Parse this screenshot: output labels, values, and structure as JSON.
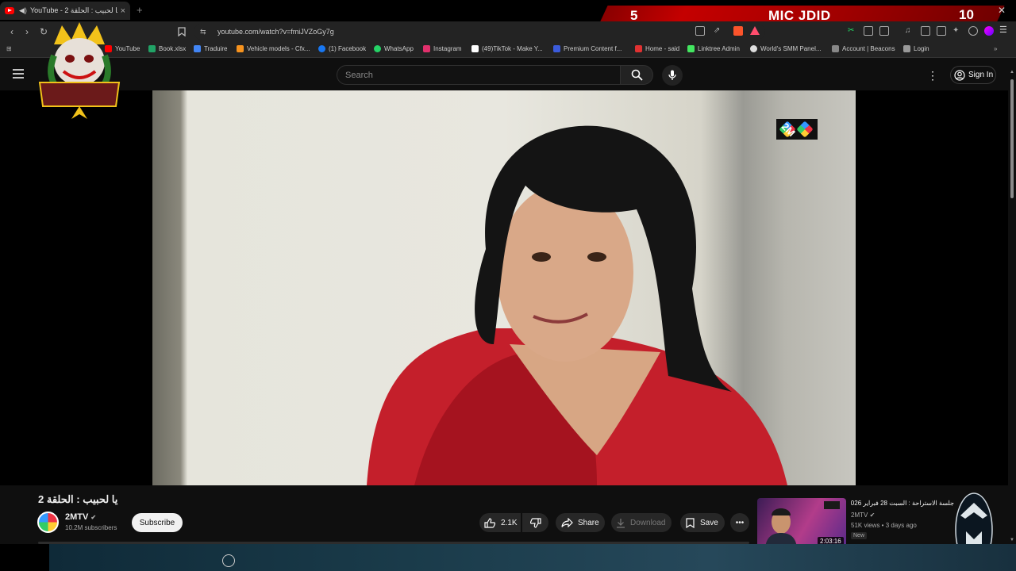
{
  "browser": {
    "tab_title": "YouTube - 2 يا لحبيب : الحلقة",
    "new_tab": "+",
    "url": "youtube.com/watch?v=fmiJVZoGy7g",
    "bookmarks": [
      {
        "label": "YouTube",
        "color": "#ff0000"
      },
      {
        "label": "Book.xlsx",
        "color": "#21a366"
      },
      {
        "label": "Traduire",
        "color": "#4285f4"
      },
      {
        "label": "Vehicle models - Cfx...",
        "color": "#f7931e"
      },
      {
        "label": "(1) Facebook",
        "color": "#1877f2"
      },
      {
        "label": "WhatsApp",
        "color": "#25d366"
      },
      {
        "label": "Instagram",
        "color": "#e1306c"
      },
      {
        "label": "(49)TikTok - Make Y...",
        "color": "#ffffff"
      },
      {
        "label": "Premium Content f...",
        "color": "#3b5bdb"
      },
      {
        "label": "Home - said",
        "color": "#e03131"
      },
      {
        "label": "Linktree Admin",
        "color": "#43e660"
      },
      {
        "label": "World's SMM Panel...",
        "color": "#dddddd"
      },
      {
        "label": "Account | Beacons",
        "color": "#888888"
      },
      {
        "label": "Login",
        "color": "#999999"
      }
    ]
  },
  "stream_overlay": {
    "left_number": "5",
    "title": "MIC JDID",
    "right_number": "10",
    "brand_text": "AIT BOUKHRIZ"
  },
  "youtube": {
    "search_placeholder": "Search",
    "sign_in": "Sign In",
    "watermark": "2M",
    "video_title": "يا لحبيب : الحلقة 2",
    "channel_name": "2MTV",
    "channel_subscribers": "10.2M subscribers",
    "subscribe": "Subscribe",
    "likes": "2.1K",
    "share": "Share",
    "download": "Download",
    "save": "Save",
    "recommended": {
      "title": "جلسة الاستراحة : السبت 28 فبراير 2026",
      "channel": "2MTV",
      "meta": "51K views • 3 days ago",
      "badge": "New",
      "duration": "2:03:16"
    }
  }
}
